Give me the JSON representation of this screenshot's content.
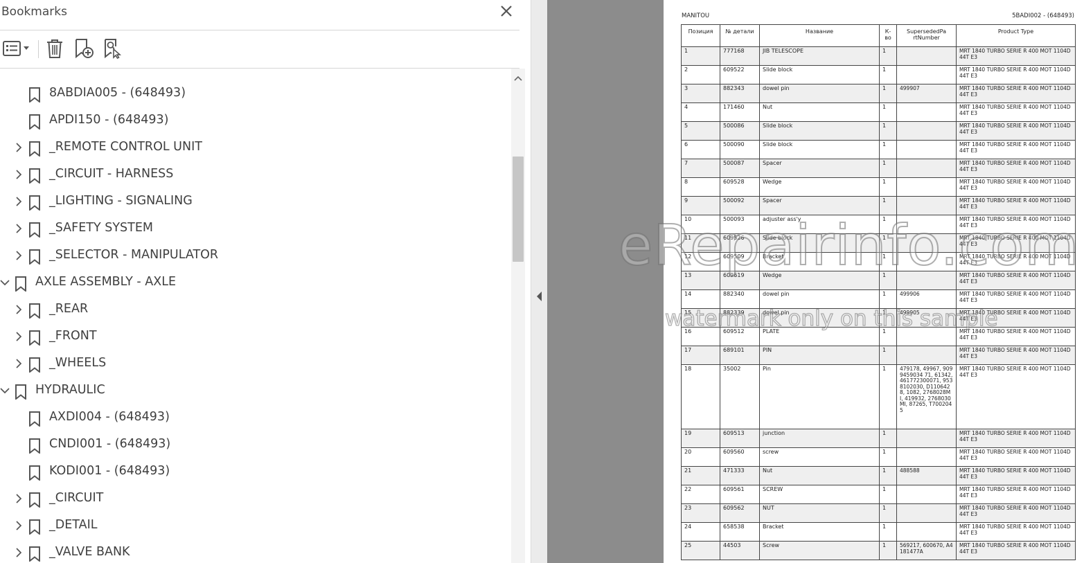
{
  "bookmarks_panel": {
    "title": "Bookmarks",
    "toolbar": {
      "options": "options-menu-icon",
      "delete": "trash-icon",
      "new_bookmark": "new-bookmark-icon",
      "find_current": "find-bookmark-icon"
    },
    "items": [
      {
        "label": "8ABDIA005 - (648493)",
        "level": 2,
        "caret": "none"
      },
      {
        "label": "APDI150 - (648493)",
        "level": 2,
        "caret": "none"
      },
      {
        "label": "_REMOTE CONTROL UNIT",
        "level": 2,
        "caret": "collapsed"
      },
      {
        "label": "_CIRCUIT - HARNESS",
        "level": 2,
        "caret": "collapsed"
      },
      {
        "label": "_LIGHTING  - SIGNALING",
        "level": 2,
        "caret": "collapsed"
      },
      {
        "label": "_SAFETY SYSTEM",
        "level": 2,
        "caret": "collapsed"
      },
      {
        "label": "_SELECTOR - MANIPULATOR",
        "level": 2,
        "caret": "collapsed"
      },
      {
        "label": "AXLE ASSEMBLY - AXLE",
        "level": 1,
        "caret": "expanded"
      },
      {
        "label": "_REAR",
        "level": 2,
        "caret": "collapsed"
      },
      {
        "label": "_FRONT",
        "level": 2,
        "caret": "collapsed"
      },
      {
        "label": "_WHEELS",
        "level": 2,
        "caret": "collapsed"
      },
      {
        "label": "HYDRAULIC",
        "level": 1,
        "caret": "expanded"
      },
      {
        "label": "AXDI004 - (648493)",
        "level": 2,
        "caret": "none"
      },
      {
        "label": "CNDI001 - (648493)",
        "level": 2,
        "caret": "none"
      },
      {
        "label": "KODI001 - (648493)",
        "level": 2,
        "caret": "none"
      },
      {
        "label": "_CIRCUIT",
        "level": 2,
        "caret": "collapsed"
      },
      {
        "label": "_DETAIL",
        "level": 2,
        "caret": "collapsed"
      },
      {
        "label": "_VALVE BANK",
        "level": 2,
        "caret": "collapsed"
      }
    ]
  },
  "document": {
    "brand": "MANITOU",
    "code": "5BADI002 - (648493)",
    "columns": [
      "Позиция",
      "№ детали",
      "Название",
      "К-во",
      "SupersededPa rtNumber",
      "Product Type"
    ],
    "rows": [
      [
        "1",
        "777168",
        "JIB TELESCOPE",
        "1",
        "",
        "MRT 1840 TURBO SERIE R 400 MOT 1104D 44T E3"
      ],
      [
        "2",
        "609522",
        "Slide block",
        "1",
        "",
        "MRT 1840 TURBO SERIE R 400 MOT 1104D 44T E3"
      ],
      [
        "3",
        "882343",
        "dowel pin",
        "1",
        "499907",
        "MRT 1840 TURBO SERIE R 400 MOT 1104D 44T E3"
      ],
      [
        "4",
        "171460",
        "Nut",
        "1",
        "",
        "MRT 1840 TURBO SERIE R 400 MOT 1104D 44T E3"
      ],
      [
        "5",
        "500086",
        "Slide block",
        "1",
        "",
        "MRT 1840 TURBO SERIE R 400 MOT 1104D 44T E3"
      ],
      [
        "6",
        "500090",
        "Slide block",
        "1",
        "",
        "MRT 1840 TURBO SERIE R 400 MOT 1104D 44T E3"
      ],
      [
        "7",
        "500087",
        "Spacer",
        "1",
        "",
        "MRT 1840 TURBO SERIE R 400 MOT 1104D 44T E3"
      ],
      [
        "8",
        "609528",
        "Wedge",
        "1",
        "",
        "MRT 1840 TURBO SERIE R 400 MOT 1104D 44T E3"
      ],
      [
        "9",
        "500092",
        "Spacer",
        "1",
        "",
        "MRT 1840 TURBO SERIE R 400 MOT 1104D 44T E3"
      ],
      [
        "10",
        "500093",
        "adjuster ass'y",
        "1",
        "",
        "MRT 1840 TURBO SERIE R 400 MOT 1104D 44T E3"
      ],
      [
        "11",
        "609526",
        "Slide block",
        "1",
        "",
        "MRT 1840 TURBO SERIE R 400 MOT 1104D 44T E3"
      ],
      [
        "12",
        "609509",
        "Bracket",
        "1",
        "",
        "MRT 1840 TURBO SERIE R 400 MOT 1104D 44T E3"
      ],
      [
        "13",
        "609619",
        "Wedge",
        "1",
        "",
        "MRT 1840 TURBO SERIE R 400 MOT 1104D 44T E3"
      ],
      [
        "14",
        "882340",
        "dowel pin",
        "1",
        "499906",
        "MRT 1840 TURBO SERIE R 400 MOT 1104D 44T E3"
      ],
      [
        "15",
        "882339",
        "dowel pin",
        "1",
        "499905",
        "MRT 1840 TURBO SERIE R 400 MOT 1104D 44T E3"
      ],
      [
        "16",
        "609512",
        "PLATE",
        "1",
        "",
        "MRT 1840 TURBO SERIE R 400 MOT 1104D 44T E3"
      ],
      [
        "17",
        "689101",
        "PIN",
        "1",
        "",
        "MRT 1840 TURBO SERIE R 400 MOT 1104D 44T E3"
      ],
      [
        "18",
        "35002",
        "Pin",
        "1",
        "479178, 49967, 9099459034 71, 61342, 461772300071, 9538102030, D1106428, 1082, 2768028MI, 419932, 2768030MI, 87265, T7002045",
        "MRT 1840 TURBO SERIE R 400 MOT 1104D 44T E3"
      ],
      [
        "19",
        "609513",
        "junction",
        "1",
        "",
        "MRT 1840 TURBO SERIE R 400 MOT 1104D 44T E3"
      ],
      [
        "20",
        "609560",
        "screw",
        "1",
        "",
        "MRT 1840 TURBO SERIE R 400 MOT 1104D 44T E3"
      ],
      [
        "21",
        "471333",
        "Nut",
        "1",
        "488588",
        "MRT 1840 TURBO SERIE R 400 MOT 1104D 44T E3"
      ],
      [
        "22",
        "609561",
        "SCREW",
        "1",
        "",
        "MRT 1840 TURBO SERIE R 400 MOT 1104D 44T E3"
      ],
      [
        "23",
        "609562",
        "NUT",
        "1",
        "",
        "MRT 1840 TURBO SERIE R 400 MOT 1104D 44T E3"
      ],
      [
        "24",
        "658538",
        "Bracket",
        "1",
        "",
        "MRT 1840 TURBO SERIE R 400 MOT 1104D 44T E3"
      ],
      [
        "25",
        "44503",
        "Screw",
        "1",
        "569217, 600670, A4181477A",
        "MRT 1840 TURBO SERIE R 400 MOT 1104D 44T E3"
      ]
    ]
  },
  "watermark": {
    "line1": "eRepairinfo.com",
    "line2": "watermark only on this sample"
  }
}
